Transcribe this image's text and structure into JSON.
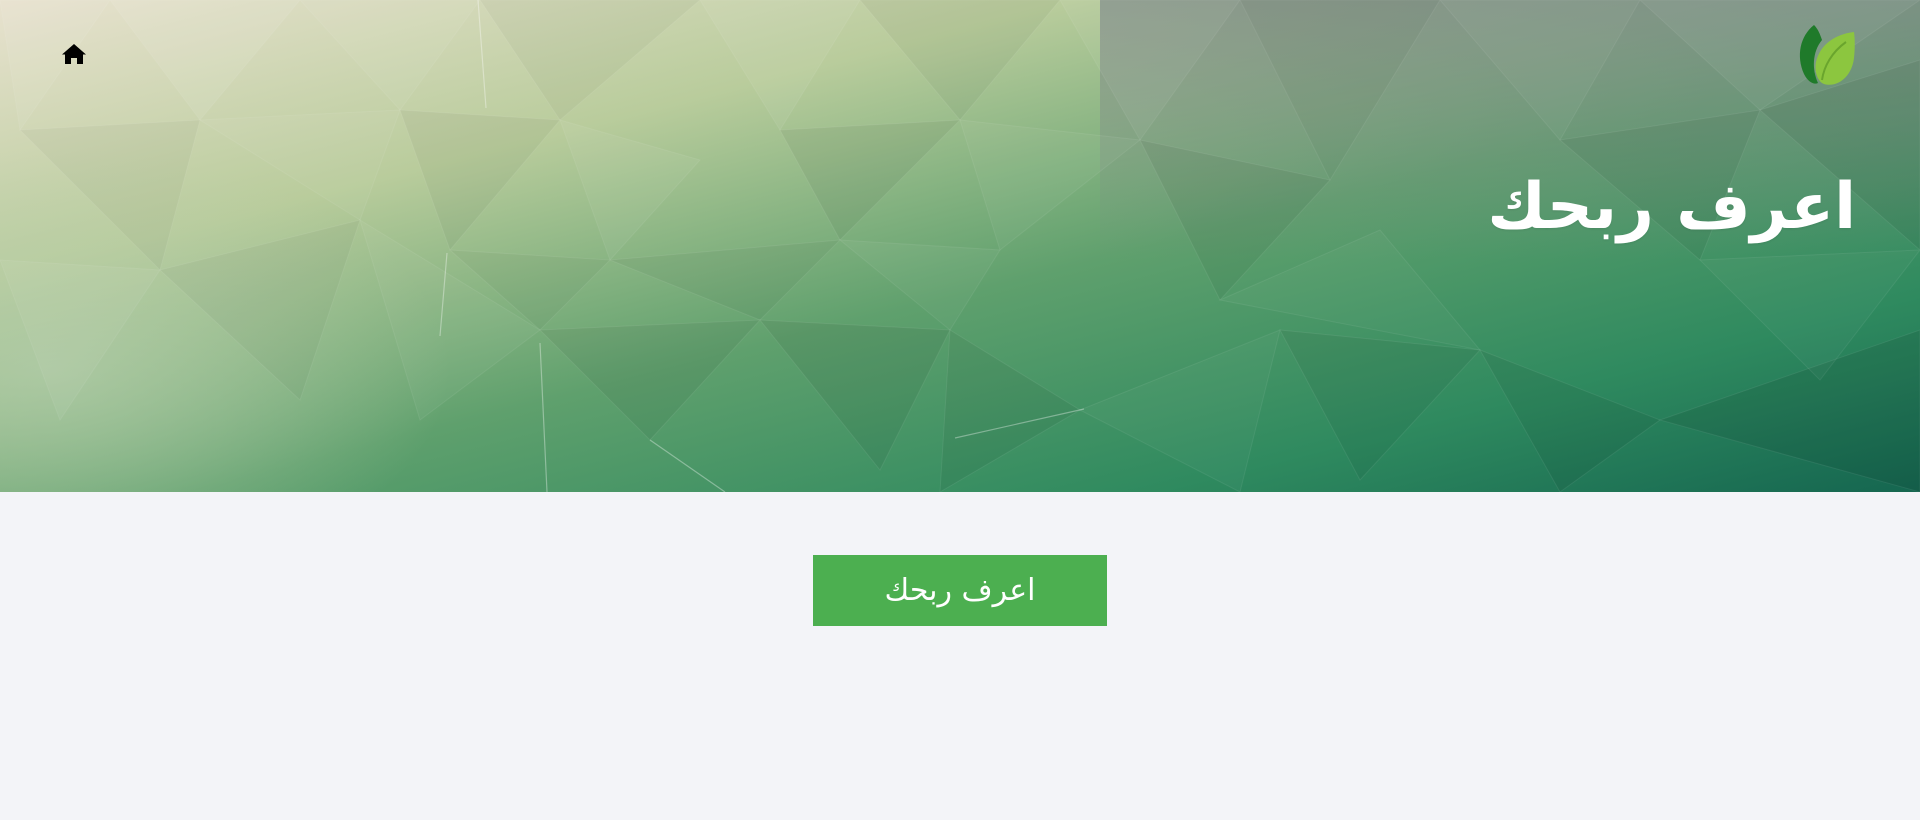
{
  "header": {
    "home_icon": "home-icon",
    "logo_icon": "leaf-logo-icon",
    "title": "اعرف ربحك"
  },
  "main": {
    "cta_label": "اعرف ربحك"
  },
  "colors": {
    "hero_top_left": "#e6dfc9",
    "hero_mid": "#7bb27b",
    "hero_bottom_right": "#1a6e52",
    "hero_top_right": "#7b8f88",
    "button": "#4caf50",
    "page_background": "#f3f4f8",
    "logo_dark_leaf": "#1f7a2a",
    "logo_light_leaf": "#8cc63f"
  }
}
